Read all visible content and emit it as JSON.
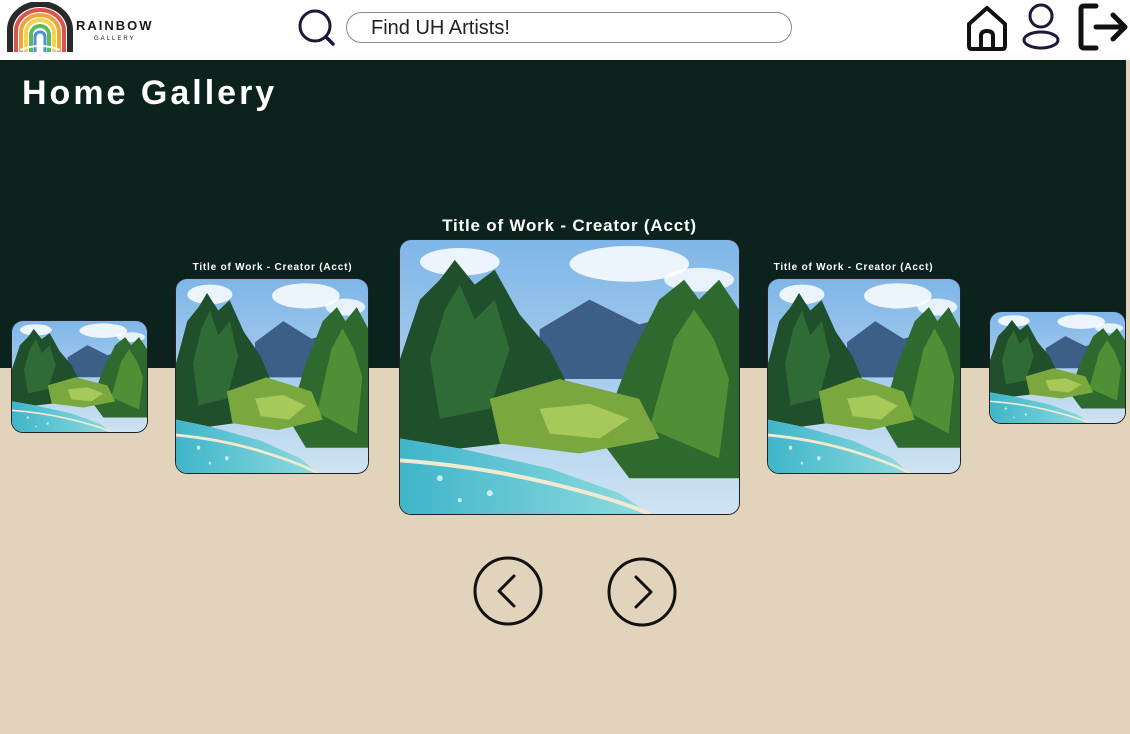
{
  "header": {
    "logo_text": "RAINBOW",
    "logo_subtext": "GALLERY",
    "search": {
      "placeholder": "Find UH Artists!",
      "icon": "search-icon"
    },
    "nav_icons": [
      "home-icon",
      "user-icon",
      "logout-icon"
    ]
  },
  "page": {
    "title": "Home Gallery"
  },
  "carousel": {
    "featured": {
      "title": "Title of Work - Creator (Acct)"
    },
    "left_near": {
      "title": "Title of Work - Creator (Acct)"
    },
    "right_near": {
      "title": "Title of Work - Creator (Acct)"
    },
    "controls": {
      "prev": "chevron-left-icon",
      "next": "chevron-right-icon"
    }
  },
  "colors": {
    "header_bg": "#ffffff",
    "hero_bg": "#0b221d",
    "page_bg": "#e2d4bc",
    "title_text": "#ffffff"
  }
}
